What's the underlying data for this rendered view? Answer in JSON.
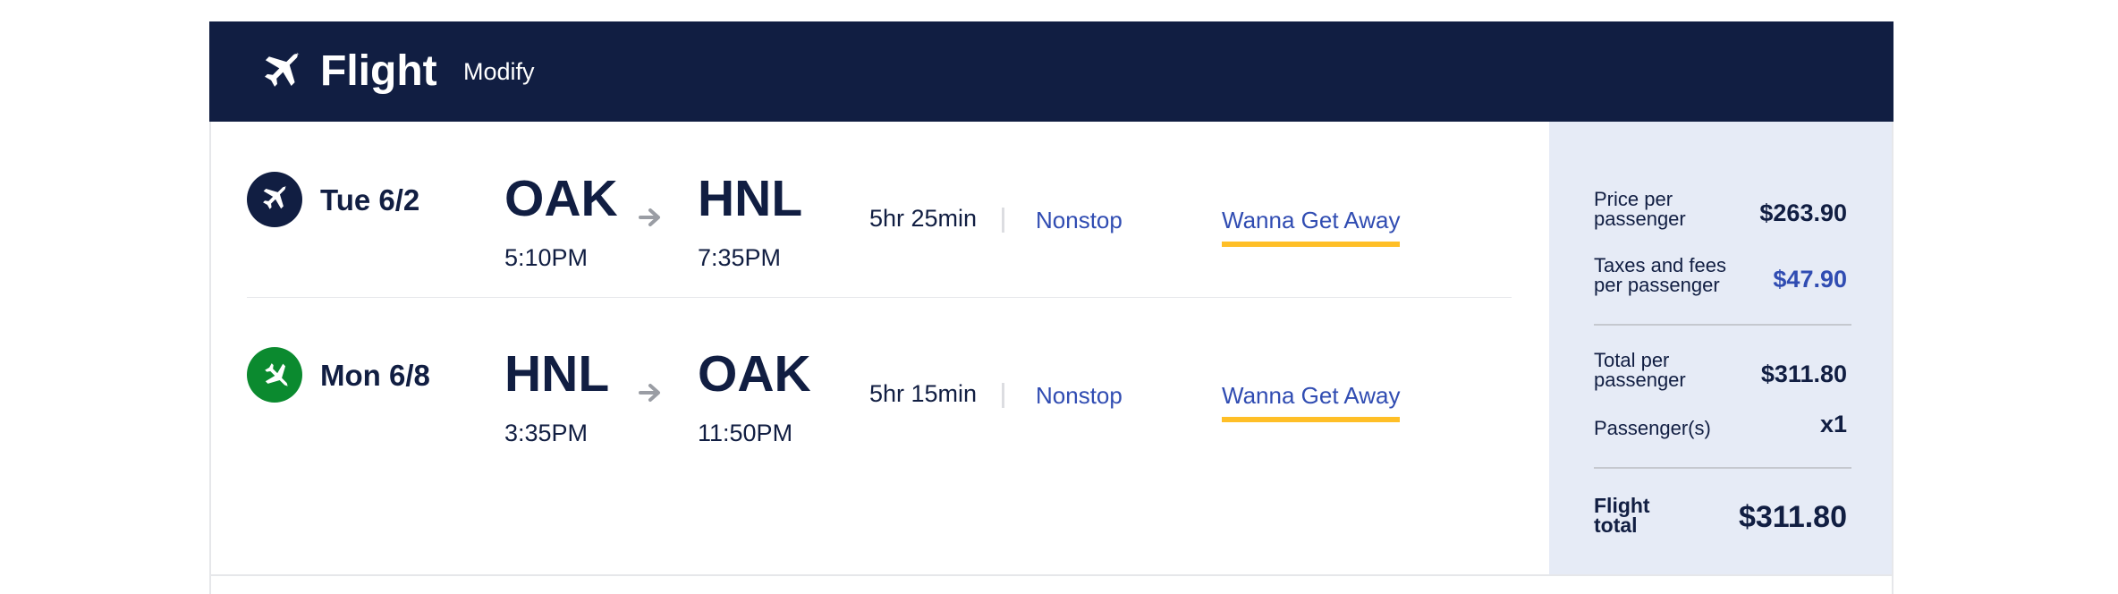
{
  "header": {
    "icon": "plane-icon",
    "title": "Flight",
    "modify_label": "Modify",
    "background": "#111e42"
  },
  "legs": [
    {
      "badge_icon": "plane-icon",
      "badge_color": "#111e42",
      "date": "Tue 6/2",
      "origin": "OAK",
      "depart_time": "5:10PM",
      "destination": "HNL",
      "arrive_time": "7:35PM",
      "duration": "5hr 25min",
      "stops": "Nonstop",
      "fare": "Wanna Get Away"
    },
    {
      "badge_icon": "plane-icon",
      "badge_color": "#0b8a2f",
      "date": "Mon 6/8",
      "origin": "HNL",
      "depart_time": "3:35PM",
      "destination": "OAK",
      "arrive_time": "11:50PM",
      "duration": "5hr 15min",
      "stops": "Nonstop",
      "fare": "Wanna Get Away"
    }
  ],
  "summary": {
    "price_per_passenger_label_1": "Price per",
    "price_per_passenger_label_2": "passenger",
    "price_per_passenger": "$263.90",
    "taxes_label_1": "Taxes and fees",
    "taxes_label_2": "per passenger",
    "taxes": "$47.90",
    "total_per_passenger_label_1": "Total per",
    "total_per_passenger_label_2": "passenger",
    "total_per_passenger": "$311.80",
    "passengers_label": "Passenger(s)",
    "passengers": "x1",
    "flight_total_label_1": "Flight",
    "flight_total_label_2": "total",
    "flight_total": "$311.80"
  },
  "colors": {
    "navy": "#111e42",
    "link_blue": "#304cb2",
    "fare_underline": "#ffbf27",
    "summary_bg": "#e6ebf6",
    "return_green": "#0b8a2f"
  }
}
